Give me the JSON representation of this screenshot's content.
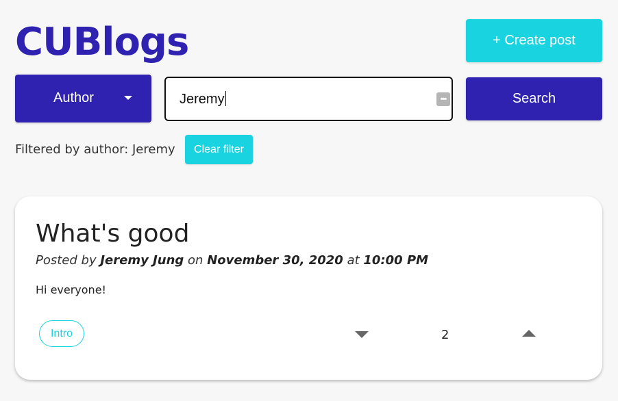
{
  "header": {
    "logo": "CUBlogs",
    "create_post_label": "+ Create post"
  },
  "search": {
    "filter_select": {
      "selected": "Author",
      "icon": "chevron-down-icon"
    },
    "query_value": "Jeremy",
    "autofill_icon": "more-dots-icon",
    "search_label": "Search"
  },
  "filter": {
    "status_text": "Filtered by author: Jeremy",
    "clear_label": "Clear filter"
  },
  "posts": [
    {
      "title": "What's good",
      "posted_by_prefix": "Posted by",
      "author": "Jeremy Jung",
      "on_word": "on",
      "date": "November 30, 2020",
      "at_word": "at",
      "time": "10:00 PM",
      "body": "Hi everyone!",
      "tags": [
        "Intro"
      ],
      "vote_count": "2"
    }
  ],
  "colors": {
    "brand": "#2f22b0",
    "accent": "#19d4e0",
    "background": "#f7f7f7"
  }
}
